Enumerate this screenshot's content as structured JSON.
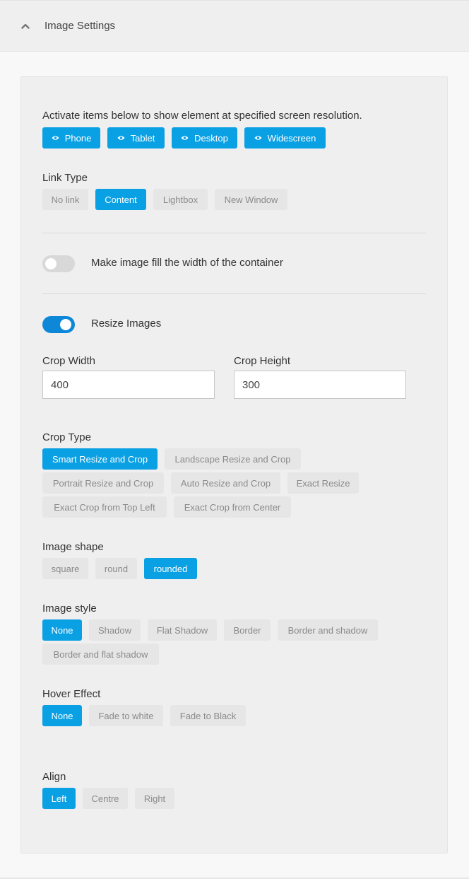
{
  "header": {
    "title": "Image Settings",
    "collapse_icon": "chevron-up-icon"
  },
  "colors": {
    "accent": "#0aa0e4",
    "toggle_on": "#0d88d8",
    "inactive_bg": "#e6e6e6",
    "inactive_text": "#8a8a8a"
  },
  "visibility": {
    "intro": "Activate items below to show element at specified screen resolution.",
    "icon": "eye-icon",
    "buttons": [
      {
        "label": "Phone",
        "active": true
      },
      {
        "label": "Tablet",
        "active": true
      },
      {
        "label": "Desktop",
        "active": true
      },
      {
        "label": "Widescreen",
        "active": true
      }
    ]
  },
  "link_type": {
    "label": "Link Type",
    "options": [
      "No link",
      "Content",
      "Lightbox",
      "New Window"
    ],
    "selected": "Content"
  },
  "fill_width": {
    "label": "Make image fill the width of the container",
    "enabled": false
  },
  "resize_images": {
    "label": "Resize Images",
    "enabled": true
  },
  "crop_width": {
    "label": "Crop Width",
    "value": "400"
  },
  "crop_height": {
    "label": "Crop Height",
    "value": "300"
  },
  "crop_type": {
    "label": "Crop Type",
    "options": [
      "Smart Resize and Crop",
      "Landscape Resize and Crop",
      "Portrait Resize and Crop",
      "Auto Resize and Crop",
      "Exact Resize",
      "Exact Crop from Top Left",
      "Exact Crop from Center"
    ],
    "selected": "Smart Resize and Crop"
  },
  "image_shape": {
    "label": "Image shape",
    "options": [
      "square",
      "round",
      "rounded"
    ],
    "selected": "rounded"
  },
  "image_style": {
    "label": "Image style",
    "options": [
      "None",
      "Shadow",
      "Flat Shadow",
      "Border",
      "Border and shadow",
      "Border and flat shadow"
    ],
    "selected": "None"
  },
  "hover_effect": {
    "label": "Hover Effect",
    "options": [
      "None",
      "Fade to white",
      "Fade to Black"
    ],
    "selected": "None"
  },
  "align": {
    "label": "Align",
    "options": [
      "Left",
      "Centre",
      "Right"
    ],
    "selected": "Left"
  }
}
